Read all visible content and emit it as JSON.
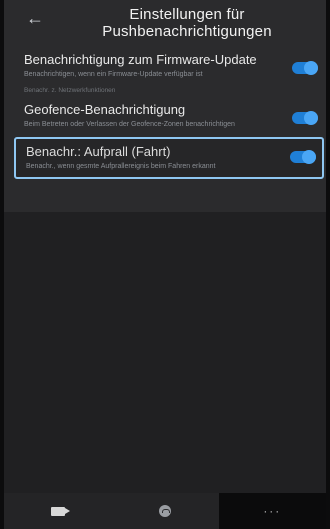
{
  "header": {
    "back_icon": "back-arrow-icon",
    "title_line1": "Einstellungen für",
    "title_line2": "Pushbenachrichtigungen"
  },
  "settings": [
    {
      "title": "Benachrichtigung zum Firmware-Update",
      "description": "Benachrichtigen, wenn ein Firmware-Update verfügbar ist",
      "enabled": true
    },
    {
      "title": "Geofence-Benachrichtigung",
      "description": "Beim Betreten oder Verlassen der Geofence-Zonen benachrichtigen",
      "enabled": true
    },
    {
      "title": "Benachr.: Aufprall (Fahrt)",
      "description": "Benachr., wenn gesmte Aufprallereignis beim Fahren erkannt",
      "enabled": true,
      "selected": true
    }
  ],
  "section_label": "Benachr. z. Netzwerkfunktionen",
  "bottom_nav": {
    "items": [
      {
        "icon": "video-camera-icon"
      },
      {
        "icon": "gauge-icon"
      },
      {
        "icon": "more-dots-icon",
        "label": "···"
      }
    ]
  },
  "colors": {
    "toggle_on": "#1f7fd6",
    "selection_border": "#8fc7f2"
  }
}
